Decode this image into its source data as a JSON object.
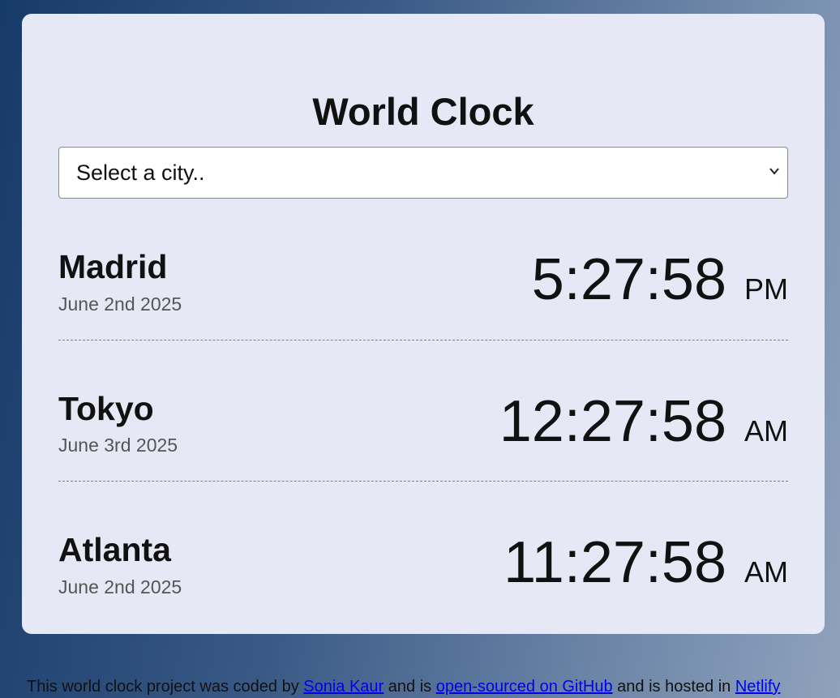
{
  "app": {
    "title": "World Clock"
  },
  "city_select": {
    "selected_label": "Select a city.."
  },
  "cities": [
    {
      "name": "Madrid",
      "date": "June 2nd 2025",
      "time": "5:27:58",
      "ampm": "PM"
    },
    {
      "name": "Tokyo",
      "date": "June 3rd 2025",
      "time": "12:27:58",
      "ampm": "AM"
    },
    {
      "name": "Atlanta",
      "date": "June 2nd 2025",
      "time": "11:27:58",
      "ampm": "AM"
    }
  ],
  "footer": {
    "text_1": "This world clock project was coded by ",
    "author_link": "Sonia Kaur",
    "text_2": " and is ",
    "github_link": "open-sourced on GitHub",
    "text_3": " and is hosted in ",
    "netlify_link": "Netlify"
  },
  "colors": {
    "card_background": "#e6e8f6",
    "link": "#0000ee",
    "date_text": "#555555"
  },
  "icons": {
    "select_chevron": "chevron-down-icon"
  }
}
